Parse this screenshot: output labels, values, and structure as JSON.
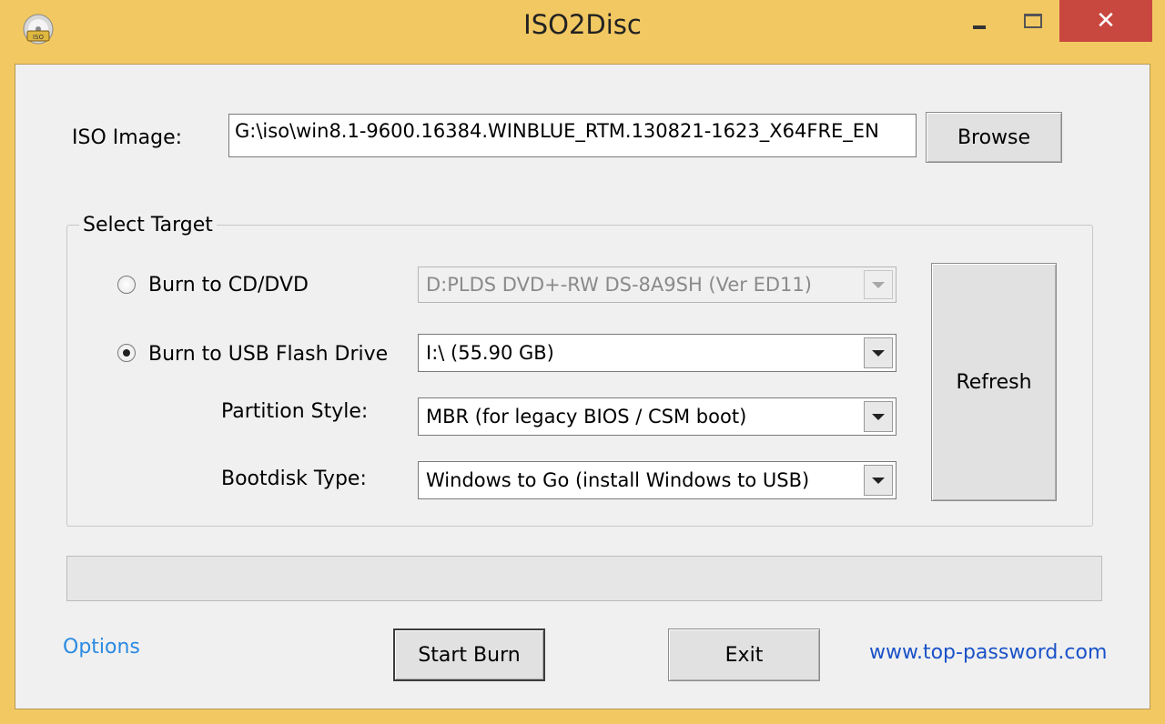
{
  "window": {
    "title": "ISO2Disc",
    "icon": "iso-disc-icon",
    "controls": {
      "minimize": "minimize-icon",
      "maximize": "maximize-icon",
      "close": "✕"
    }
  },
  "iso_image": {
    "label": "ISO Image:",
    "value": "G:\\iso\\win8.1-9600.16384.WINBLUE_RTM.130821-1623_X64FRE_EN",
    "browse_label": "Browse"
  },
  "select_target": {
    "title": "Select Target",
    "burn_cd": {
      "label": "Burn to CD/DVD",
      "selected": false,
      "drive": "D:PLDS DVD+-RW DS-8A9SH (Ver ED11)"
    },
    "burn_usb": {
      "label": "Burn to USB Flash Drive",
      "selected": true,
      "drive": "I:\\ (55.90 GB)"
    },
    "partition_style": {
      "label": "Partition Style:",
      "value": "MBR (for legacy BIOS / CSM boot)"
    },
    "bootdisk_type": {
      "label": "Bootdisk Type:",
      "value": "Windows to Go (install Windows to USB)"
    },
    "refresh_label": "Refresh"
  },
  "progress": {
    "value": 0
  },
  "footer": {
    "options_label": "Options",
    "start_burn_label": "Start Burn",
    "exit_label": "Exit",
    "website": "www.top-password.com"
  },
  "colors": {
    "frame": "#f2c862",
    "close": "#c8473f",
    "client": "#f0f0f0",
    "options_link": "#2a8ae2",
    "site_link": "#1a52c8"
  }
}
